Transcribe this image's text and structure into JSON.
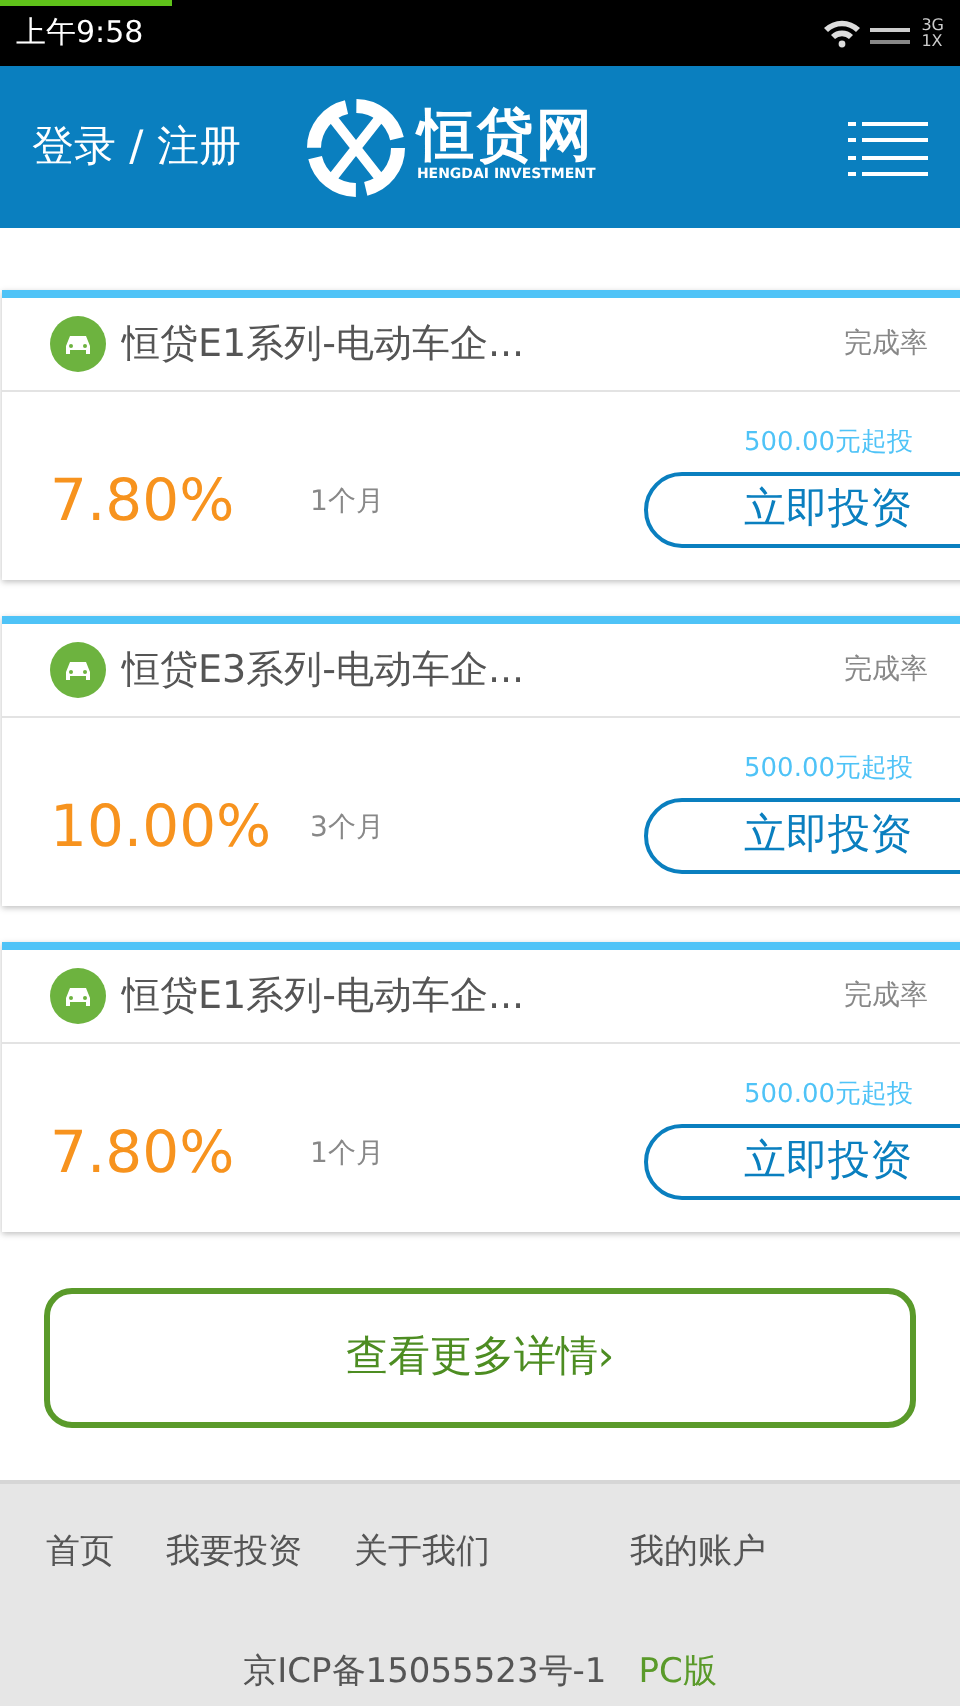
{
  "status_bar": {
    "time": "上午9:58",
    "network": "3G",
    "sim": "1X",
    "loading": {
      "level": 0.18
    }
  },
  "header": {
    "login": "登录 / 注册",
    "logo_name": "恒贷网",
    "logo_tagline": "HENGDAI INVESTMENT"
  },
  "products": [
    {
      "title": "恒贷E1系列-电动车企...",
      "completion_label": "完成率",
      "min_invest": "500.00元起投",
      "rate": "7.80%",
      "term": "1个月",
      "button": "立即投资"
    },
    {
      "title": "恒贷E3系列-电动车企...",
      "completion_label": "完成率",
      "min_invest": "500.00元起投",
      "rate": "10.00%",
      "term": "3个月",
      "button": "立即投资"
    },
    {
      "title": "恒贷E1系列-电动车企...",
      "completion_label": "完成率",
      "min_invest": "500.00元起投",
      "rate": "7.80%",
      "term": "1个月",
      "button": "立即投资"
    }
  ],
  "more_button": "查看更多详情›",
  "footer": {
    "links": [
      "首页",
      "我要投资",
      "关于我们",
      "我的账户"
    ],
    "icp": "京ICP备15055523号-1",
    "pc_link": "PC版"
  }
}
